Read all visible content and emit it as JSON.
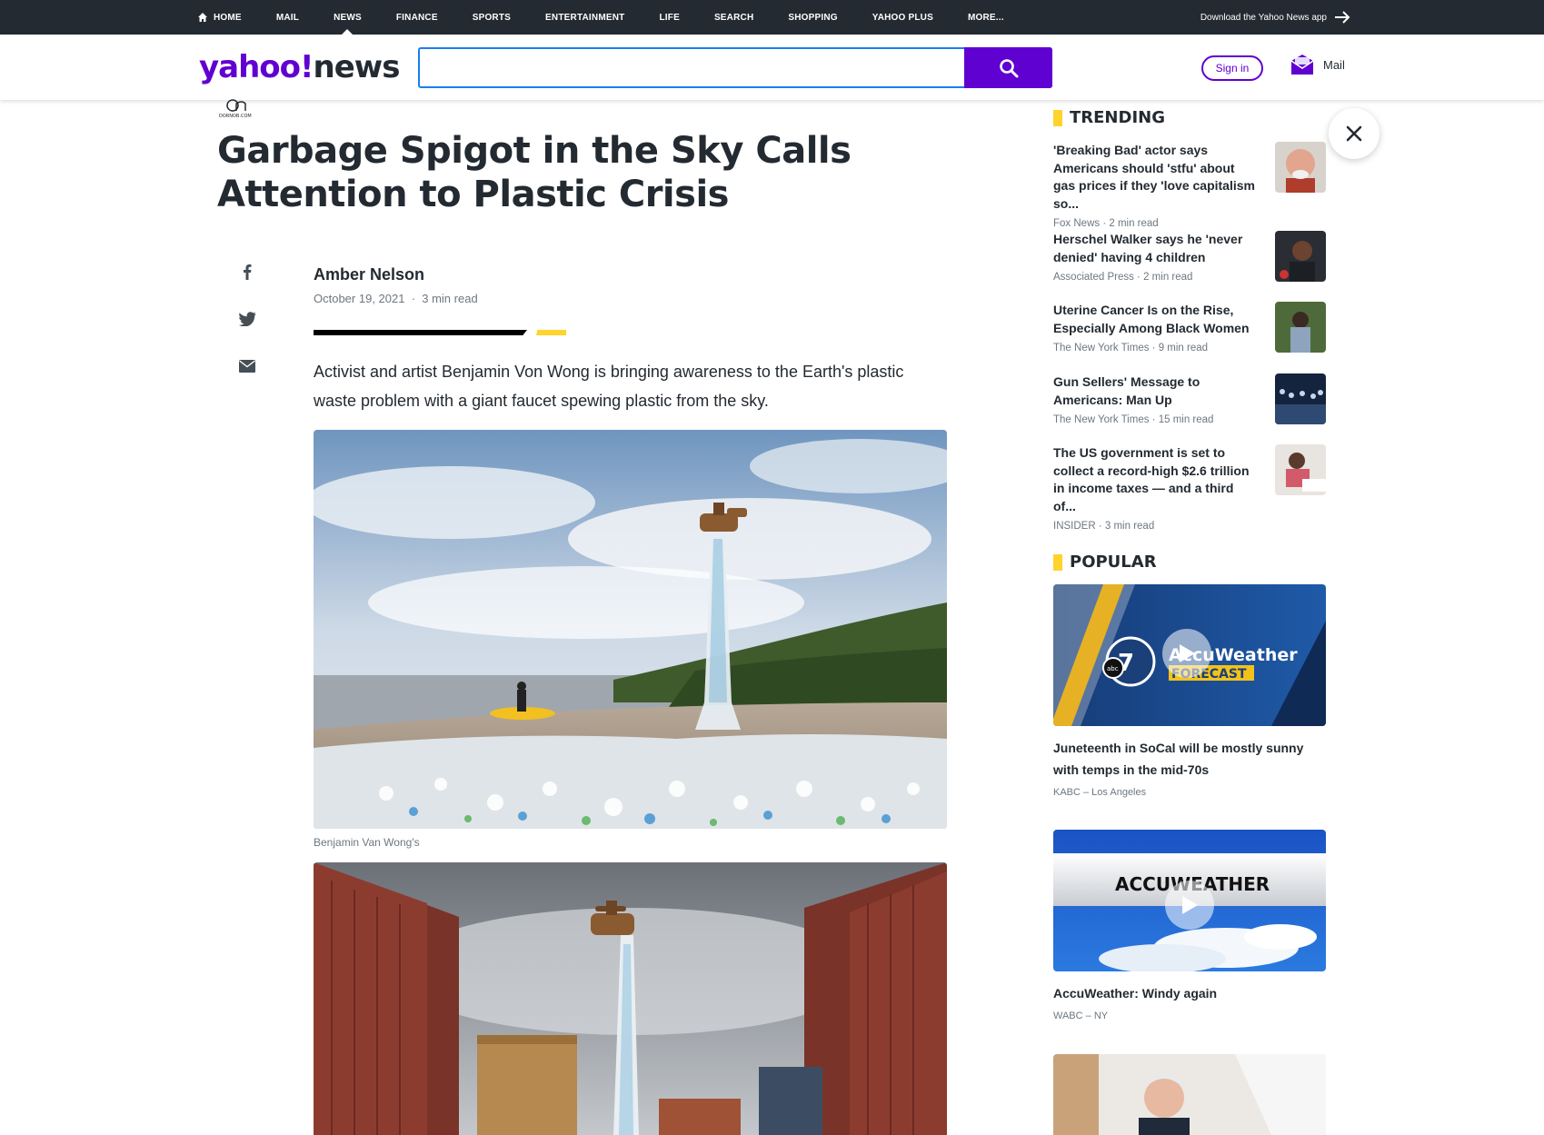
{
  "topnav": {
    "items": [
      "HOME",
      "MAIL",
      "NEWS",
      "FINANCE",
      "SPORTS",
      "ENTERTAINMENT",
      "LIFE",
      "SEARCH",
      "SHOPPING",
      "YAHOO PLUS",
      "MORE..."
    ],
    "active": "NEWS",
    "download_app": "Download the Yahoo News app"
  },
  "header": {
    "logo_yahoo": "yahoo!",
    "logo_news": "news",
    "search_placeholder": "",
    "signin": "Sign in",
    "mail": "Mail"
  },
  "article": {
    "source_logo_text": "DORNOB.COM",
    "title": "Garbage Spigot in the Sky Calls Attention to Plastic Crisis",
    "author": "Amber Nelson",
    "date": "October 19, 2021",
    "read_time": "3 min read",
    "lede": "Activist and artist Benjamin Von Wong is bringing awareness to the Earth's plastic waste problem with a giant faucet spewing plastic from the sky.",
    "caption1": "Benjamin Van Wong's"
  },
  "trending": {
    "heading": "TRENDING",
    "items": [
      {
        "title": "'Breaking Bad' actor says Americans should 'stfu' about gas prices if they 'love capitalism so...",
        "source": "Fox News",
        "read": "2 min read"
      },
      {
        "title": "Herschel Walker says he 'never denied' having 4 children",
        "source": "Associated Press",
        "read": "2 min read"
      },
      {
        "title": "Uterine Cancer Is on the Rise, Especially Among Black Women",
        "source": "The New York Times",
        "read": "9 min read"
      },
      {
        "title": "Gun Sellers' Message to Americans: Man Up",
        "source": "The New York Times",
        "read": "15 min read"
      },
      {
        "title": "The US government is set to collect a record-high $2.6 trillion in income taxes — and a third of...",
        "source": "INSIDER",
        "read": "3 min read"
      }
    ]
  },
  "popular": {
    "heading": "POPULAR",
    "items": [
      {
        "title": "Juneteenth in SoCal will be mostly sunny with temps in the mid-70s",
        "source": "KABC – Los Angeles",
        "thumb_text": "AccuWeather",
        "thumb_sub": "FORECAST"
      },
      {
        "title": "AccuWeather: Windy again",
        "source": "WABC – NY",
        "thumb_text": "ACCUWEATHER"
      }
    ]
  },
  "colors": {
    "yahoo_purple": "#6001d2",
    "topbar": "#232a31",
    "accent_yellow": "#ffd32c"
  }
}
